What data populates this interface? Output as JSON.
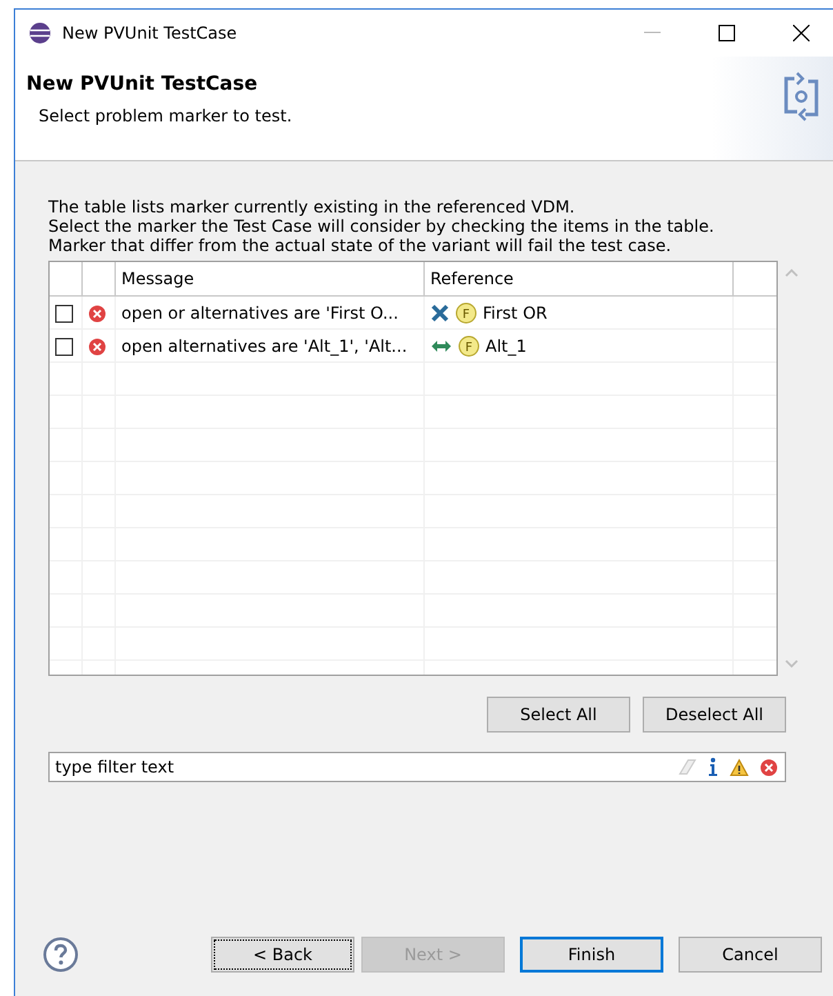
{
  "window": {
    "title": "New PVUnit TestCase"
  },
  "header": {
    "title": "New PVUnit TestCase",
    "subtitle": "Select problem marker to test."
  },
  "description": [
    "The table lists marker currently existing in the referenced VDM.",
    "Select the marker the Test Case will consider by checking the items in the table.",
    "Marker that differ from the actual state of the variant will fail the test case."
  ],
  "table": {
    "columns": [
      "Message",
      "Reference"
    ],
    "rows": [
      {
        "checked": false,
        "message": "open or alternatives are 'First O...",
        "reference": "First OR",
        "kind": "or",
        "feature_badge": "F"
      },
      {
        "checked": false,
        "message": "open alternatives are 'Alt_1', 'Alt...",
        "reference": "Alt_1",
        "kind": "alternative",
        "feature_badge": "F"
      }
    ]
  },
  "selection_buttons": [
    "Select All",
    "Deselect All"
  ],
  "filter": {
    "placeholder": "type filter text"
  },
  "buttons": [
    {
      "label": "< Back",
      "disabled": false,
      "default": false,
      "focused": true
    },
    {
      "label": "Next >",
      "disabled": true,
      "default": false,
      "focused": false
    },
    {
      "label": "Finish",
      "disabled": false,
      "default": true,
      "focused": false
    },
    {
      "label": "Cancel",
      "disabled": false,
      "default": false,
      "focused": false
    }
  ]
}
